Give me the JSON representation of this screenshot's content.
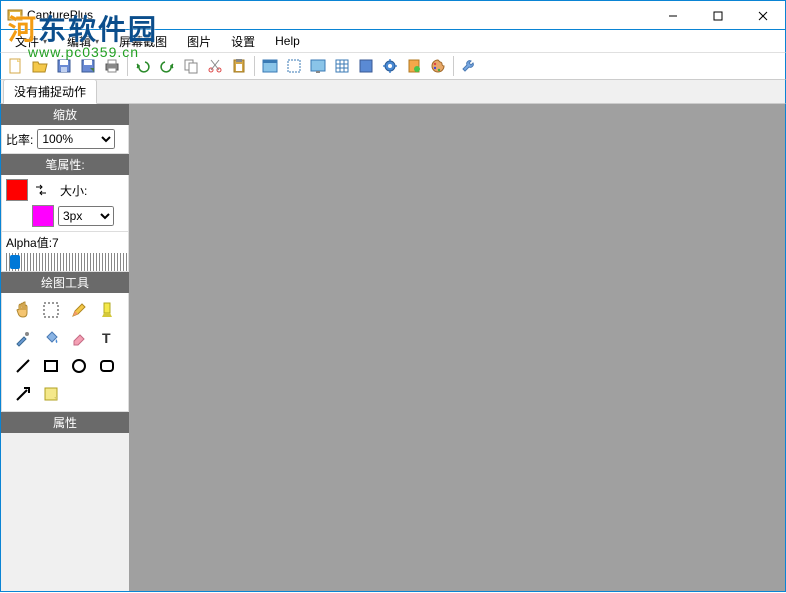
{
  "app": {
    "title": "CapturePlus"
  },
  "watermark": {
    "text": "河东软件园",
    "url": "www.pc0359.cn"
  },
  "menubar": {
    "items": [
      {
        "label": "文件",
        "has_dropdown": true
      },
      {
        "label": "编辑",
        "has_dropdown": true
      },
      {
        "label": "屏幕截图",
        "has_dropdown": false
      },
      {
        "label": "图片",
        "has_dropdown": false
      },
      {
        "label": "设置",
        "has_dropdown": false
      },
      {
        "label": "Help",
        "has_dropdown": false
      }
    ]
  },
  "toolbar": {
    "icons": [
      "new-doc-icon",
      "open-icon",
      "save-icon",
      "save-as-icon",
      "print-icon",
      "undo-icon",
      "redo-icon",
      "copy-icon",
      "cut-icon",
      "paste-icon",
      "capture-window-icon",
      "capture-region-icon",
      "capture-fullscreen-icon",
      "grid-icon",
      "fit-icon",
      "settings-gear-icon",
      "clipboard-icon",
      "palette-icon",
      "sep",
      "wrench-icon"
    ]
  },
  "tab": {
    "label": "没有捕捉动作"
  },
  "sidebar": {
    "zoom": {
      "header": "缩放",
      "ratio_label": "比率:",
      "value": "100%"
    },
    "pen": {
      "header": "笔属性:",
      "size_label": "大小:",
      "size_value": "3px",
      "alpha_label": "Alpha值:",
      "alpha_value": "7"
    },
    "tools": {
      "header": "绘图工具",
      "items": [
        "hand-icon",
        "marquee-icon",
        "pencil-icon",
        "highlighter-icon",
        "eyedropper-icon",
        "bucket-icon",
        "eraser-icon",
        "text-icon",
        "line-icon",
        "rect-icon",
        "circle-icon",
        "rounded-rect-icon",
        "arrow-icon",
        "note-icon"
      ]
    },
    "props": {
      "header": "属性"
    }
  }
}
